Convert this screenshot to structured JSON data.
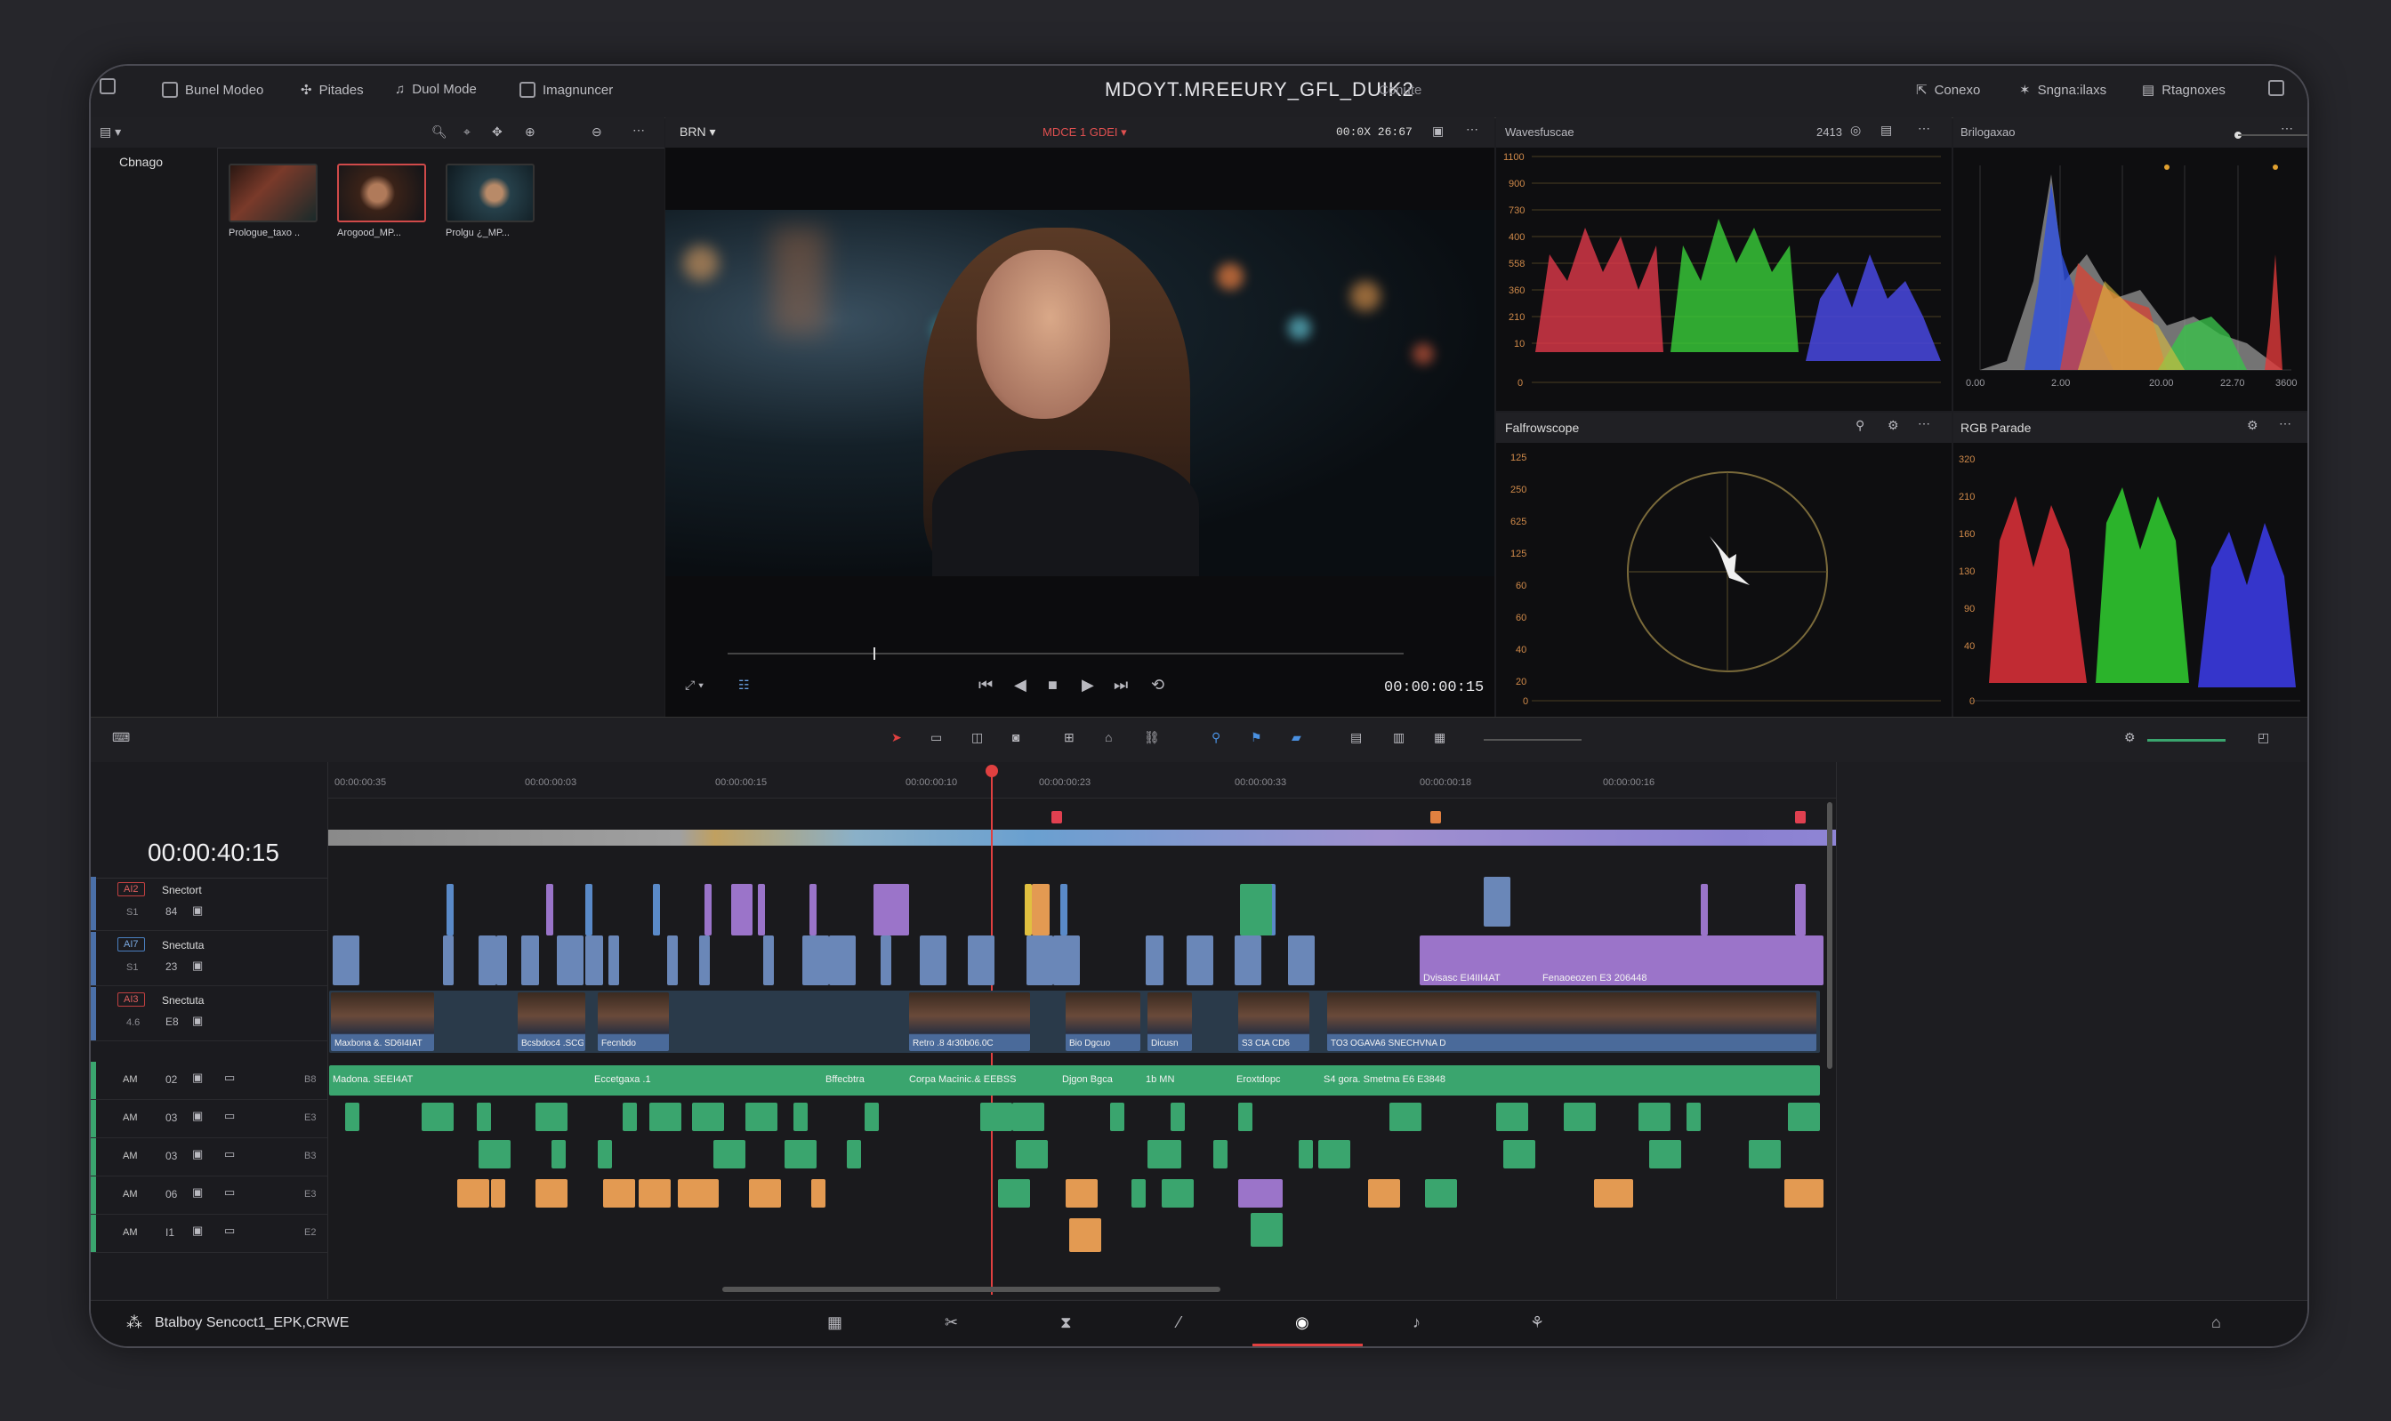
{
  "topbar": {
    "title": "MDOYT.MREEURY_GFL_DUIK2",
    "subtitle": "Conute",
    "left_items": [
      "Bunel Modeo",
      "Pitades",
      "Duol Mode",
      "Imagnuncer"
    ],
    "right_items": [
      "Conexo",
      "Sngna:ilaxs",
      "Rtagnoxes"
    ]
  },
  "media": {
    "header": "Cbnago",
    "clips": [
      "Prologue_taxo ..",
      "Arogood_MP...",
      "Prolgu ¿_MP..."
    ]
  },
  "viewer": {
    "dropdown": "BRN",
    "mode": "MDCE 1 GDEI",
    "timecode_top": "00:0X 26:67",
    "timecode_bottom": "00:00:00:15"
  },
  "scopes": {
    "waveform": {
      "title": "Wavesfuscae",
      "value": "2413",
      "ticks": [
        "1100",
        "900",
        "730",
        "400",
        "558",
        "360",
        "210",
        "10",
        "0"
      ]
    },
    "histogram": {
      "title": "Brilogaxao",
      "ticks": [
        "0.00",
        "2.00",
        "20.00",
        "22.70",
        "3600"
      ]
    },
    "vectorscope": {
      "title": "Falfrowscope",
      "ticks": [
        "125",
        "250",
        "625",
        "125",
        "60",
        "60",
        "40",
        "20",
        "0"
      ]
    },
    "parade": {
      "title": "RGB Parade",
      "ticks": [
        "320",
        "210",
        "160",
        "130",
        "90",
        "40",
        "0"
      ]
    }
  },
  "timeline": {
    "timecode": "00:00:40:15",
    "ruler": [
      "00:00:00:35",
      "00:00:00:03",
      "00:00:00:15",
      "00:00:00:10",
      "00:00:00:23",
      "00:00:00:33",
      "00:00:00:18",
      "00:00:00:16"
    ],
    "video_tracks": [
      {
        "badge": "AI2",
        "name": "Snectort",
        "num": "84",
        "sub": "S1"
      },
      {
        "badge": "AI7",
        "name": "Snectuta",
        "num": "23",
        "sub": "S1"
      },
      {
        "badge": "AI3",
        "name": "Snectuta",
        "num": "E8",
        "sub": "4.6"
      }
    ],
    "audio_tracks": [
      {
        "a": "AM",
        "num": "02",
        "right": "B8"
      },
      {
        "a": "AM",
        "num": "03",
        "right": "E3"
      },
      {
        "a": "AM",
        "num": "03",
        "right": "B3"
      },
      {
        "a": "AM",
        "num": "06",
        "right": "E3"
      },
      {
        "a": "AM",
        "num": "I1",
        "right": "E2"
      }
    ],
    "clip_labels": {
      "purple_long": "Dvisasc EI4III4AT",
      "purple_long2": "Fenaoeozen E3 206448",
      "video_main": "Maxbona &. SD6I4IAT",
      "video_2": "Bcsbdoc4 .SCGT",
      "video_3": "Fecnbdo",
      "video_4": "Retro .8 4r30b06.0C",
      "video_5": "Bio Dgcuo",
      "video_6": "Dicusn",
      "video_7": "S3 CtA CD6",
      "video_8": "TO3 OGAVA6 SNECHVNA D",
      "audio_main": "Madona. SEEI4AT",
      "audio_2": "Eccetgaxa .1",
      "audio_3": "Bffecbtra",
      "audio_4": "Corpa Macinic.& EEBSS",
      "audio_5": "Djgon Bgca",
      "audio_6": "1b MN",
      "audio_7": "Eroxtdopc",
      "audio_8": "S4 gora. Smetma E6 E3848"
    }
  },
  "footer": {
    "project": "Btalboy Sencoct1_EPK,CRWE"
  }
}
